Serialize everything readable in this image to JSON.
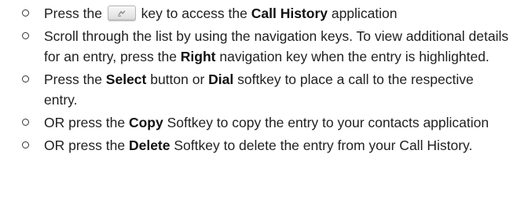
{
  "steps": [
    {
      "before": "Press the ",
      "icon": "call-history-key-icon",
      "after": " key to access the ",
      "bold": "Call History",
      "end": " application"
    },
    {
      "text1": "Scroll through the list by using the navigation keys. To view additional details for an entry, press the ",
      "bold1": "Right",
      "text2": " navigation key when the entry is highlighted."
    },
    {
      "text1": "Press the ",
      "bold1": "Select",
      "text2": " button or ",
      "bold2": "Dial",
      "text3": " softkey to place a call to the respective entry."
    },
    {
      "text1": "OR press the ",
      "bold1": "Copy",
      "text2": " Softkey to copy the entry to your contacts application"
    },
    {
      "text1": "OR press the ",
      "bold1": "Delete",
      "text2": " Softkey to delete the entry from your Call History."
    }
  ]
}
